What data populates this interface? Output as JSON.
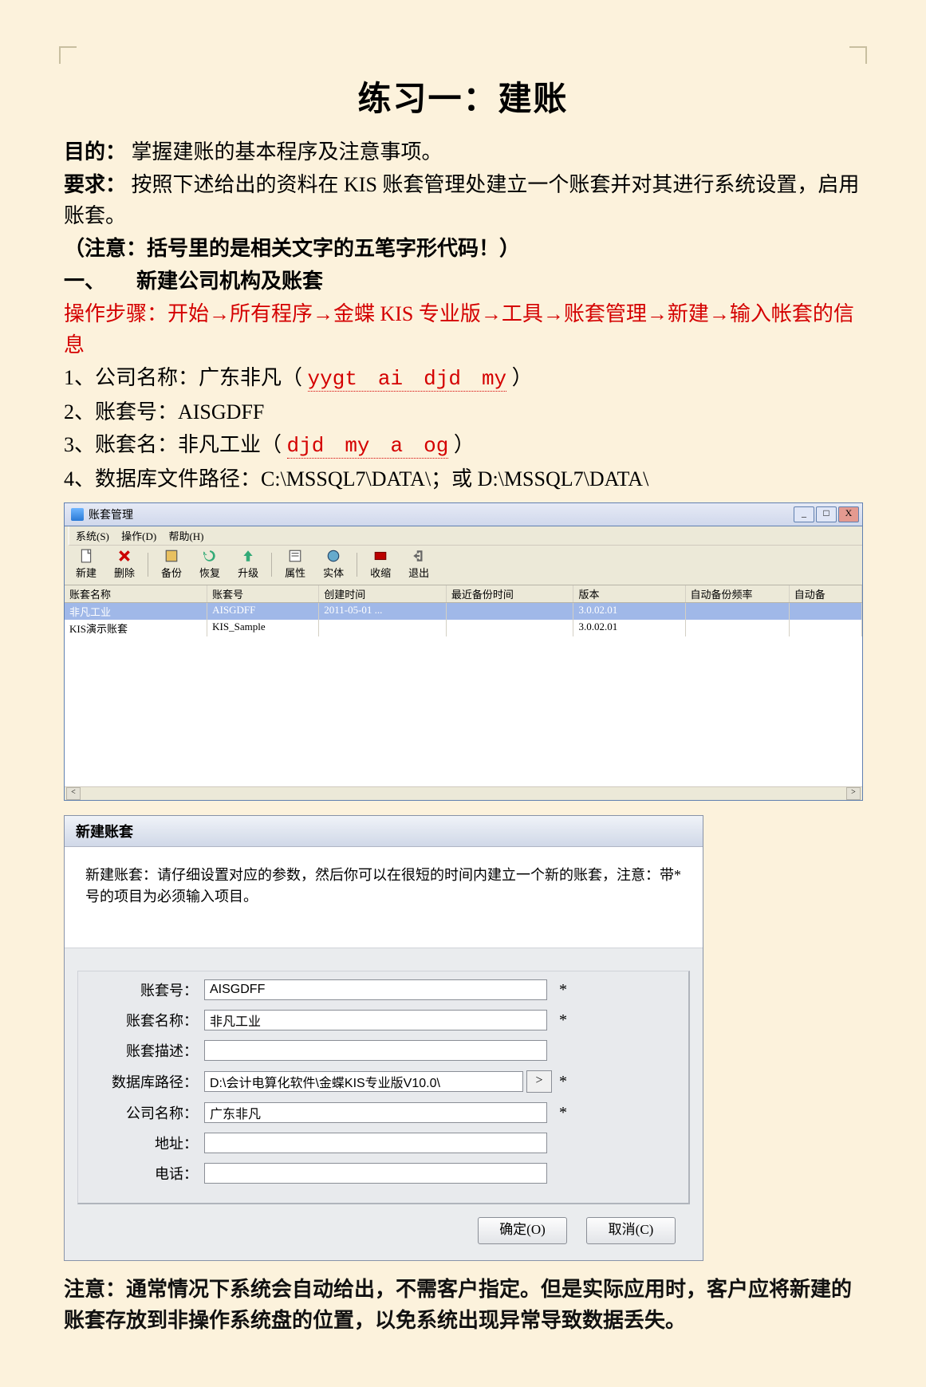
{
  "title": "练习一：建账",
  "p_goal_label": "目的：",
  "p_goal_text": "掌握建账的基本程序及注意事项。",
  "p_req_label": "要求：",
  "p_req_text": "按照下述给出的资料在 KIS 账套管理处建立一个账套并对其进行系统设置，启用账套。",
  "p_note1": "（注意：括号里的是相关文字的五笔字形代码！）",
  "p_sec1": "一、　　新建公司机构及账套",
  "p_steps": "操作步骤：开始→所有程序→金蝶 KIS 专业版→工具→账套管理→新建→输入帐套的信息",
  "li1_a": "1、公司名称：广东非凡（",
  "li1_codes": "yygt　ai　djd　my",
  "li1_b": "）",
  "li2": "2、账套号：AISGDFF",
  "li3_a": "3、账套名：非凡工业（",
  "li3_codes": "djd　my　a　og",
  "li3_b": "）",
  "li4": "4、数据库文件路径：C:\\MSSQL7\\DATA\\；或 D:\\MSSQL7\\DATA\\",
  "win1": {
    "title": "账套管理",
    "menu": {
      "sys": "系统(S)",
      "op": "操作(D)",
      "help": "帮助(H)"
    },
    "tb": {
      "new": "新建",
      "del": "删除",
      "backup": "备份",
      "restore": "恢复",
      "upgrade": "升级",
      "prop": "属性",
      "entity": "实体",
      "collapse": "收缩",
      "exit": "退出"
    },
    "cols": {
      "c0": "账套名称",
      "c1": "账套号",
      "c2": "创建时间",
      "c3": "最近备份时间",
      "c4": "版本",
      "c5": "自动备份频率",
      "c6": "自动备"
    },
    "rows": [
      {
        "c0": "非凡工业",
        "c1": "AISGDFF",
        "c2": "2011-05-01 ...",
        "c3": "",
        "c4": "3.0.02.01",
        "c5": "",
        "c6": ""
      },
      {
        "c0": "KIS演示账套",
        "c1": "KIS_Sample",
        "c2": "",
        "c3": "",
        "c4": "3.0.02.01",
        "c5": "",
        "c6": ""
      }
    ],
    "winbtn": {
      "min": "_",
      "max": "□",
      "close": "X"
    },
    "scroll": {
      "left": "<",
      "right": ">"
    }
  },
  "dlg": {
    "title": "新建账套",
    "msg": "新建账套：请仔细设置对应的参数，然后你可以在很短的时间内建立一个新的账套，注意：带*号的项目为必须输入项目。",
    "fields": {
      "no_label": "账套号：",
      "no_val": "AISGDFF",
      "no_req": "*",
      "name_label": "账套名称：",
      "name_val": "非凡工业",
      "name_req": "*",
      "desc_label": "账套描述：",
      "desc_val": "",
      "path_label": "数据库路径：",
      "path_val": "D:\\会计电算化软件\\金蝶KIS专业版V10.0\\",
      "path_btn": ">",
      "path_req": "*",
      "co_label": "公司名称：",
      "co_val": "广东非凡",
      "co_req": "*",
      "addr_label": "地址：",
      "addr_val": "",
      "tel_label": "电话：",
      "tel_val": ""
    },
    "btns": {
      "ok": "确定(O)",
      "cancel": "取消(C)"
    }
  },
  "footnote": "注意：通常情况下系统会自动给出，不需客户指定。但是实际应用时，客户应将新建的账套存放到非操作系统盘的位置，以免系统出现异常导致数据丢失。"
}
